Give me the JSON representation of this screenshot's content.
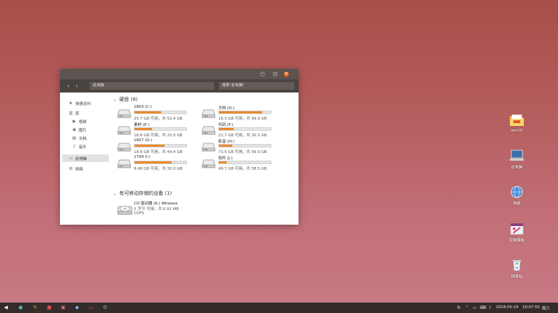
{
  "window": {
    "address": "此电脑",
    "search_placeholder": "搜索\"此电脑\"",
    "controls": {
      "minimize": "−",
      "maximize": "○",
      "close": "×"
    }
  },
  "navigation": {
    "back": "‹",
    "forward": "›"
  },
  "sidebar": {
    "items": [
      {
        "label": "快速访问",
        "icon": "star-icon"
      },
      {
        "label": "库",
        "icon": "library-icon"
      },
      {
        "label": "视频",
        "icon": "video-icon"
      },
      {
        "label": "图片",
        "icon": "camera-icon"
      },
      {
        "label": "文档",
        "icon": "document-icon"
      },
      {
        "label": "音乐",
        "icon": "music-icon"
      },
      {
        "label": "此电脑",
        "icon": "computer-icon",
        "selected": true
      },
      {
        "label": "网络",
        "icon": "network-icon"
      }
    ]
  },
  "content": {
    "drives_group": "硬盘 (8)",
    "removable_group": "有可移动存储的设备 (1)",
    "drives": [
      {
        "name": "1803 (C:)",
        "free_text": "25.7 GB 可用，共 52.4 GB",
        "used_fraction": 0.51
      },
      {
        "name": "文档 (D:)",
        "free_text": "16.3 GB 可用，共 99.9 GB",
        "used_fraction": 0.84
      },
      {
        "name": "素材 (E:)",
        "free_text": "16.6 GB 可用，共 25.0 GB",
        "used_fraction": 0.34
      },
      {
        "name": "代码 (F:)",
        "free_text": "21.7 GB 可用，共 30.5 GB",
        "used_fraction": 0.29
      },
      {
        "name": "1607 (G:)",
        "free_text": "18.8 GB 可用，共 44.4 GB",
        "used_fraction": 0.58
      },
      {
        "name": "影音 (H:)",
        "free_text": "73.5 GB 可用，共 99.9 GB",
        "used_fraction": 0.26
      },
      {
        "name": "1709 (I:)",
        "free_text": "8.48 GB 可用，共 30.0 GB",
        "used_fraction": 0.72
      },
      {
        "name": "软件 (J:)",
        "free_text": "49.7 GB 可用，共 58.5 GB",
        "used_fraction": 0.15
      }
    ],
    "cd": {
      "name": "CD 驱动器 (K:) Wireless",
      "free_text": "0 字节 可用，共 6.91 MB",
      "filesystem": "CDFS"
    }
  },
  "desktop": {
    "icons": [
      {
        "label": "win10",
        "icon": "folder-icon"
      },
      {
        "label": "此电脑",
        "icon": "computer-icon"
      },
      {
        "label": "网络",
        "icon": "network-globe-icon"
      },
      {
        "label": "控制面板",
        "icon": "control-panel-icon"
      },
      {
        "label": "回收站",
        "icon": "recycle-bin-icon"
      }
    ]
  },
  "taskbar": {
    "apps": [
      {
        "name": "start",
        "glyph": "◀",
        "color": "#ffffff"
      },
      {
        "name": "chat",
        "glyph": "●",
        "color": "#4cb3a8"
      },
      {
        "name": "pen",
        "glyph": "✎",
        "color": "#e8b43a"
      },
      {
        "name": "doc",
        "glyph": "■",
        "color": "#e14a4a"
      },
      {
        "name": "files",
        "glyph": "▣",
        "color": "#d96e8e"
      },
      {
        "name": "game",
        "glyph": "◆",
        "color": "#8db7e8"
      },
      {
        "name": "computer",
        "glyph": "▭",
        "color": "#d9415a"
      },
      {
        "name": "settings",
        "glyph": "⚙",
        "color": "#7bb36a"
      }
    ],
    "date": "2018-05-19",
    "time": "10:07:55",
    "weekday": "周六",
    "tray_icons": [
      "sort-icon",
      "chevron-up-icon",
      "message-icon",
      "keyboard-icon",
      "volume-icon",
      "battery-icon",
      "notification-icon"
    ]
  },
  "colors": {
    "accent_orange": "#ec8a2a",
    "titlebar": "#5b5450",
    "close_button": "#f36e23"
  }
}
